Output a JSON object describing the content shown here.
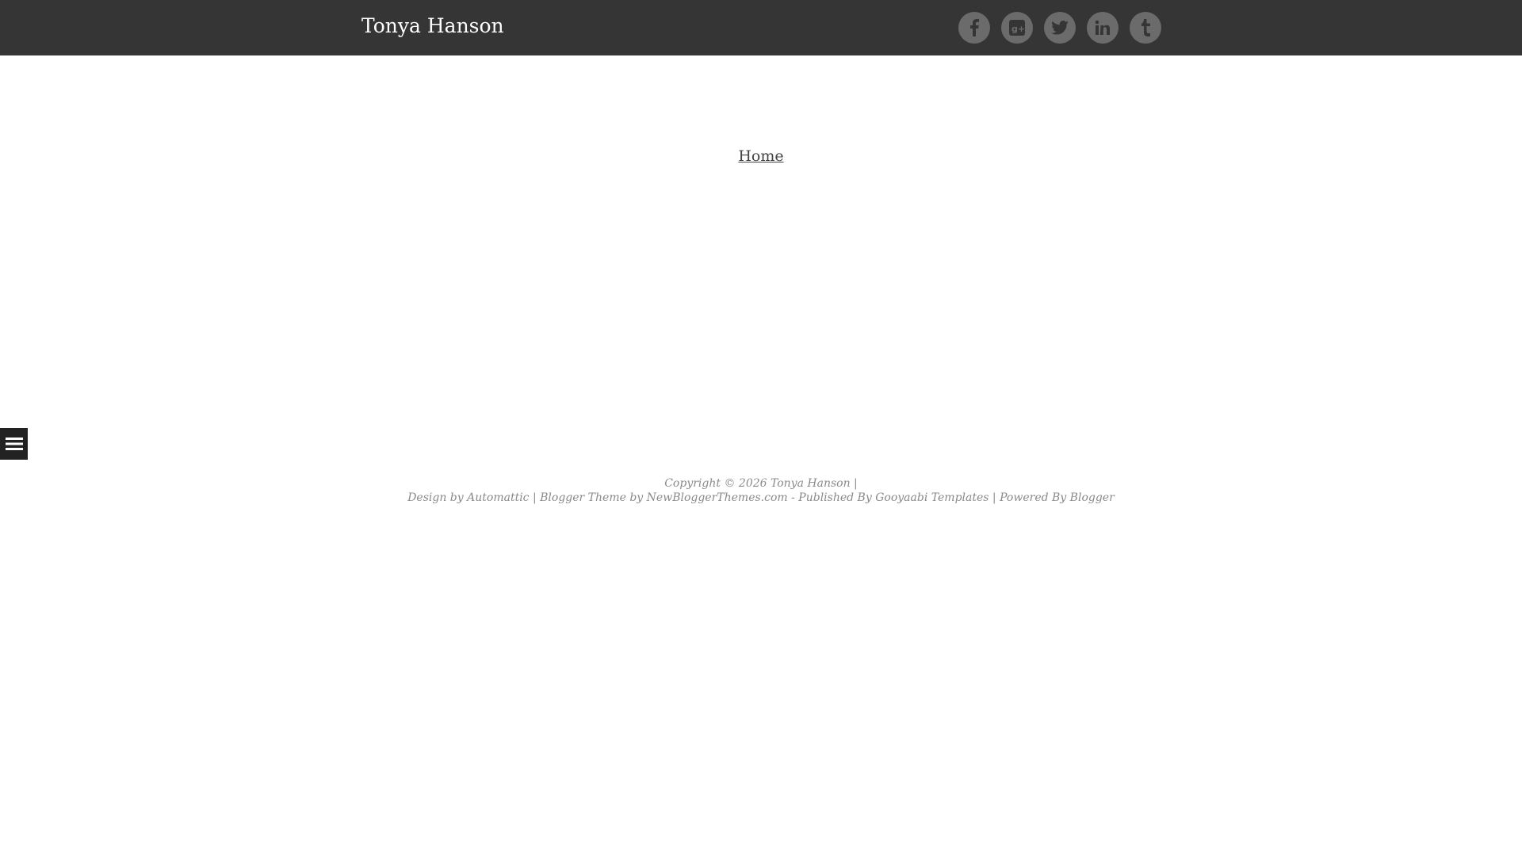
{
  "header": {
    "site_title": "Tonya Hanson",
    "social": [
      {
        "name": "facebook-icon",
        "label": "f"
      },
      {
        "name": "google-plus-icon",
        "label": "g+"
      },
      {
        "name": "twitter-icon",
        "label": "twitter"
      },
      {
        "name": "linkedin-icon",
        "label": "in"
      },
      {
        "name": "tumblr-icon",
        "label": "t"
      }
    ]
  },
  "nav": {
    "home_label": "Home"
  },
  "footer": {
    "copyright": "Copyright © 2026 Tonya Hanson |",
    "design_by_prefix": "Design by",
    "automattic": "Automattic",
    "sep1": "|",
    "blogger_theme_by": "Blogger Theme by",
    "newbloggerthemes": "NewBloggerThemes.com",
    "published_by": "- Published By",
    "gooyaabi": "Gooyaabi Templates",
    "sep2": "|",
    "powered_by": "Powered By",
    "blogger": "Blogger"
  },
  "colors": {
    "topbar": "#353535",
    "social_bg": "#6b6b6b",
    "menu_toggle": "#222222",
    "footer_text": "#8a8a8a"
  }
}
